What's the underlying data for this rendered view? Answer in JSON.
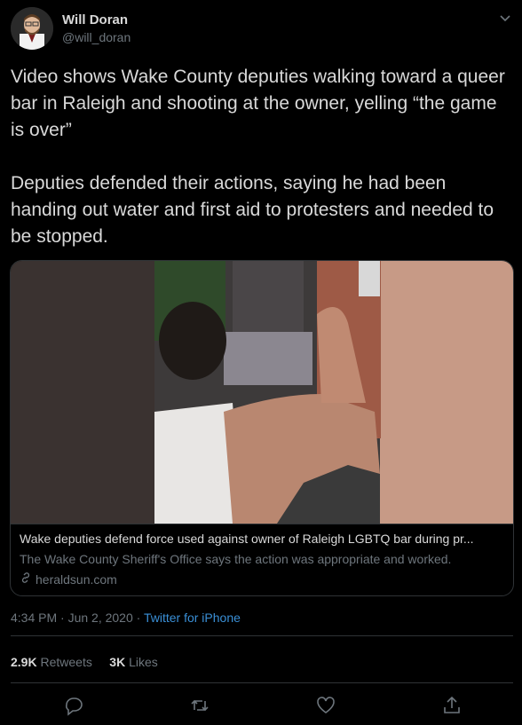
{
  "author": {
    "name": "Will Doran",
    "handle": "@will_doran"
  },
  "tweet": {
    "text": "Video shows Wake County deputies walking toward a queer bar in Raleigh and shooting at the owner, yelling “the game is over”\n\nDeputies defended their actions, saying he had been handing out water and first aid to protesters and needed to be stopped."
  },
  "card": {
    "title": "Wake deputies defend force used against owner of Raleigh LGBTQ bar during pr...",
    "description": "The Wake County Sheriff's Office says the action was appropriate and worked.",
    "domain": "heraldsun.com"
  },
  "meta": {
    "time": "4:34 PM · Jun 2, 2020 · ",
    "source": "Twitter for iPhone"
  },
  "stats": {
    "retweets_count": "2.9K",
    "retweets_label": "Retweets",
    "likes_count": "3K",
    "likes_label": "Likes"
  },
  "icons": [
    "chevron-down-icon",
    "link-icon",
    "reply-icon",
    "retweet-icon",
    "like-icon",
    "share-icon"
  ],
  "colors": {
    "background": "#000000",
    "text": "#d9d9d9",
    "muted": "#6e767d",
    "accent": "#3a8fd6",
    "border": "#2f3336"
  }
}
